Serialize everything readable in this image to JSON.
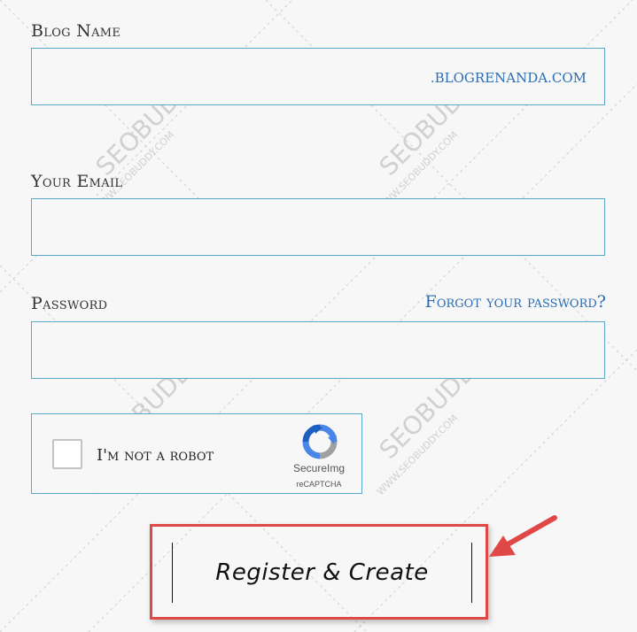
{
  "form": {
    "blog_name_label": "Blog Name",
    "blog_name_value": "",
    "blog_name_suffix": ".BLOGRENANDA.COM",
    "email_label": "Your Email",
    "email_value": "",
    "password_label": "Password",
    "password_value": "",
    "forgot_link": "Forgot your password?"
  },
  "captcha": {
    "label": "I'm not a robot",
    "brand": "SecureImg",
    "sub": "reCAPTCHA"
  },
  "register_button": "Register & Create",
  "watermark": {
    "brand": "SEOBUDDY",
    "url": "WWW.SEOBUDDY.COM"
  },
  "colors": {
    "field_border": "#5aa6c7",
    "link": "#2a6db5",
    "highlight": "#e04848",
    "background": "#f7f7f7"
  }
}
